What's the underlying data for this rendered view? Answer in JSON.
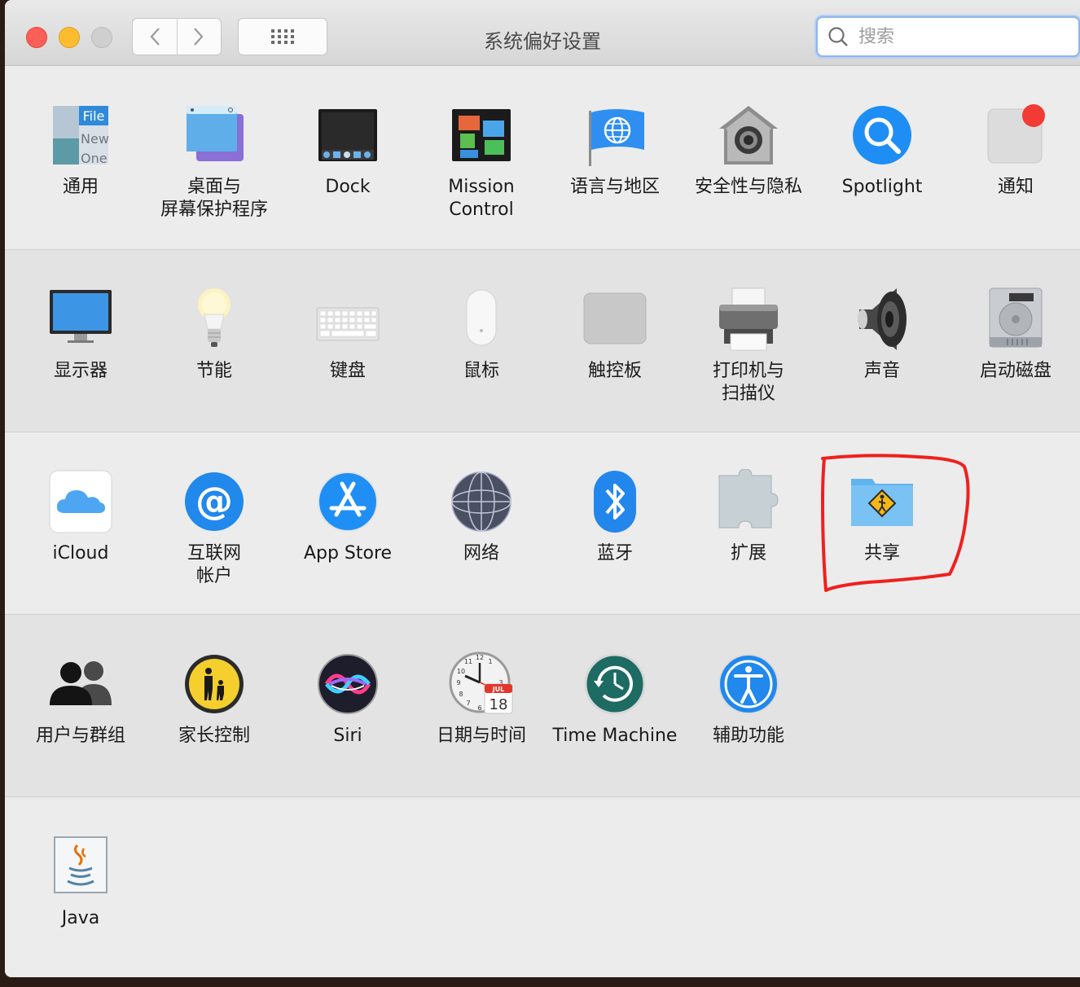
{
  "window": {
    "title": "系统偏好设置",
    "search_placeholder": "搜索"
  },
  "sections": [
    {
      "items": [
        {
          "name": "general",
          "label": "通用",
          "icon": "general-icon"
        },
        {
          "name": "desktop-screensaver",
          "label": "桌面与\n屏幕保护程序",
          "icon": "desktop-icon"
        },
        {
          "name": "dock",
          "label": "Dock",
          "icon": "dock-icon"
        },
        {
          "name": "mission-control",
          "label": "Mission\nControl",
          "icon": "mission-control-icon"
        },
        {
          "name": "language-region",
          "label": "语言与地区",
          "icon": "flag-globe-icon"
        },
        {
          "name": "security-privacy",
          "label": "安全性与隐私",
          "icon": "house-safe-icon"
        },
        {
          "name": "spotlight",
          "label": "Spotlight",
          "icon": "magnifier-icon"
        },
        {
          "name": "notifications",
          "label": "通知",
          "icon": "notification-icon"
        }
      ]
    },
    {
      "items": [
        {
          "name": "displays",
          "label": "显示器",
          "icon": "monitor-icon"
        },
        {
          "name": "energy-saver",
          "label": "节能",
          "icon": "lightbulb-icon"
        },
        {
          "name": "keyboard",
          "label": "键盘",
          "icon": "keyboard-icon"
        },
        {
          "name": "mouse",
          "label": "鼠标",
          "icon": "mouse-icon"
        },
        {
          "name": "trackpad",
          "label": "触控板",
          "icon": "trackpad-icon"
        },
        {
          "name": "printers-scanners",
          "label": "打印机与\n扫描仪",
          "icon": "printer-icon"
        },
        {
          "name": "sound",
          "label": "声音",
          "icon": "speaker-icon"
        },
        {
          "name": "startup-disk",
          "label": "启动磁盘",
          "icon": "hard-disk-icon"
        }
      ]
    },
    {
      "items": [
        {
          "name": "icloud",
          "label": "iCloud",
          "icon": "cloud-icon"
        },
        {
          "name": "internet-accounts",
          "label": "互联网\n帐户",
          "icon": "at-sign-icon"
        },
        {
          "name": "app-store",
          "label": "App Store",
          "icon": "app-store-icon"
        },
        {
          "name": "network",
          "label": "网络",
          "icon": "network-globe-icon"
        },
        {
          "name": "bluetooth",
          "label": "蓝牙",
          "icon": "bluetooth-icon"
        },
        {
          "name": "extensions",
          "label": "扩展",
          "icon": "puzzle-icon"
        },
        {
          "name": "sharing",
          "label": "共享",
          "icon": "shared-folder-icon"
        }
      ]
    },
    {
      "items": [
        {
          "name": "users-groups",
          "label": "用户与群组",
          "icon": "users-icon"
        },
        {
          "name": "parental-controls",
          "label": "家长控制",
          "icon": "parental-icon"
        },
        {
          "name": "siri",
          "label": "Siri",
          "icon": "siri-icon"
        },
        {
          "name": "date-time",
          "label": "日期与时间",
          "icon": "clock-calendar-icon",
          "calendar_month": "JUL",
          "calendar_day": "18"
        },
        {
          "name": "time-machine",
          "label": "Time Machine",
          "icon": "time-machine-icon"
        },
        {
          "name": "accessibility",
          "label": "辅助功能",
          "icon": "accessibility-icon"
        }
      ]
    },
    {
      "items": [
        {
          "name": "java",
          "label": "Java",
          "icon": "java-icon"
        }
      ]
    }
  ],
  "colors": {
    "annotation": "#f0201e",
    "accent_blue": "#1e8ef5"
  }
}
